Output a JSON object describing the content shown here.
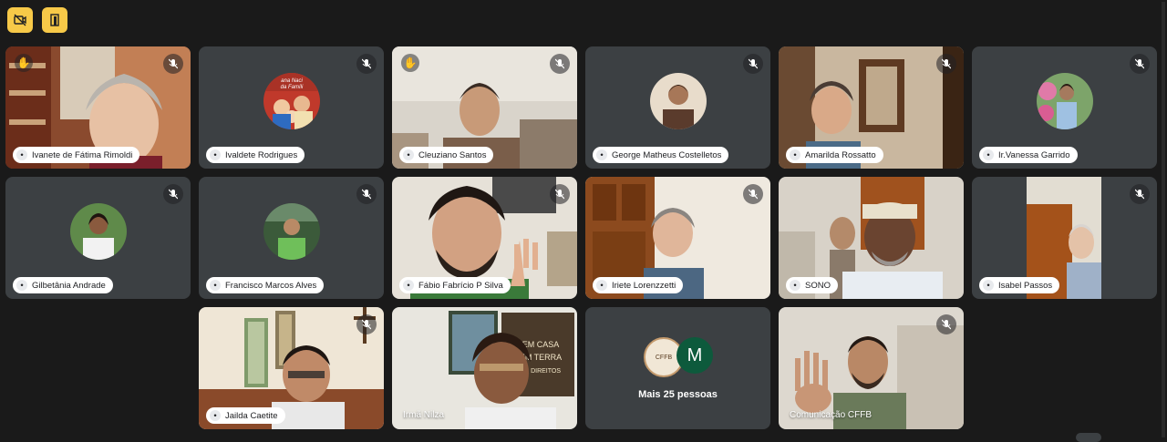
{
  "toolbar": {
    "camera_icon": "camera-off-icon",
    "door_icon": "leave-room-icon",
    "accent": "#f7c948"
  },
  "tiles": [
    {
      "name": "Ivanete de Fátima Rimoldi",
      "type": "video",
      "hand": true
    },
    {
      "name": "Ivaldete Rodrigues",
      "type": "avatar"
    },
    {
      "name": "Cleuziano Santos",
      "type": "video",
      "hand": true
    },
    {
      "name": "George Matheus Costelletos",
      "type": "avatar"
    },
    {
      "name": "Amarilda Rossatto",
      "type": "video"
    },
    {
      "name": "Ir.Vanessa Garrido",
      "type": "avatar"
    },
    {
      "name": "Gilbetânia Andrade",
      "type": "avatar"
    },
    {
      "name": "Francisco Marcos Alves",
      "type": "avatar"
    },
    {
      "name": "Fábio Fabrício P Silva",
      "type": "video"
    },
    {
      "name": "Iriete Lorenzzetti",
      "type": "video"
    },
    {
      "name": "SONO",
      "type": "video"
    },
    {
      "name": "Isabel Passos",
      "type": "video"
    },
    {
      "name": "Jailda Caetite",
      "type": "video"
    },
    {
      "name": "Irmã Nilza",
      "type": "video"
    },
    {
      "name": "Mais 25 pessoas",
      "type": "more",
      "avatar_letter": "M"
    },
    {
      "name": "Comunicação CFFB",
      "type": "video"
    }
  ],
  "avatar_text": {
    "ivaldete_banner": "ana Naci\nda Famíli"
  },
  "poster": {
    "line1": "SEM CASA",
    "line2": "SEM TERRA",
    "line3": "SEM DIREITOS"
  }
}
